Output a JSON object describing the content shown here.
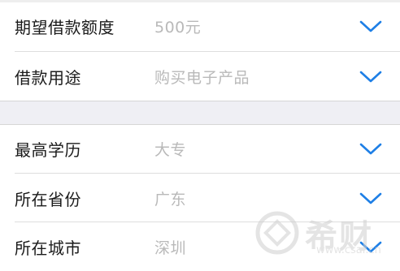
{
  "form": {
    "rows": [
      {
        "label": "期望借款额度",
        "value": "500元"
      },
      {
        "label": "借款用途",
        "value": "购买电子产品"
      },
      {
        "label": "最高学历",
        "value": "大专"
      },
      {
        "label": "所在省份",
        "value": "广东"
      },
      {
        "label": "所在城市",
        "value": "深圳"
      }
    ],
    "accent_color": "#1e7fe6",
    "value_color": "#b9b9b9",
    "chevron_icon": "chevron-down-icon"
  },
  "watermark": {
    "brand": "希财",
    "url": "www.csai.cn"
  }
}
